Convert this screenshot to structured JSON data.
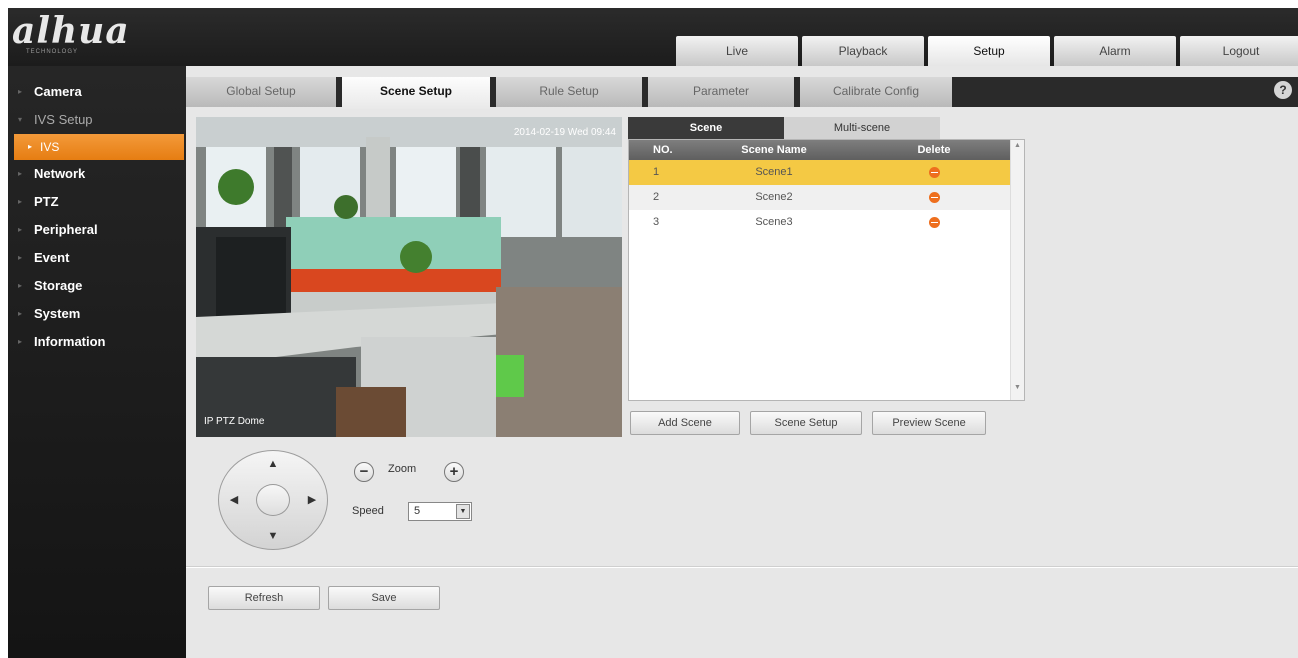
{
  "header": {
    "logo": "alhua",
    "logo_sub": "TECHNOLOGY",
    "tabs": [
      {
        "label": "Live"
      },
      {
        "label": "Playback"
      },
      {
        "label": "Setup"
      },
      {
        "label": "Alarm"
      },
      {
        "label": "Logout"
      }
    ],
    "active_tab": "Setup"
  },
  "sidebar": {
    "items": [
      {
        "label": "Camera"
      },
      {
        "label": "IVS Setup"
      },
      {
        "label": "IVS"
      },
      {
        "label": "Network"
      },
      {
        "label": "PTZ"
      },
      {
        "label": "Peripheral"
      },
      {
        "label": "Event"
      },
      {
        "label": "Storage"
      },
      {
        "label": "System"
      },
      {
        "label": "Information"
      }
    ],
    "active_item": "IVS"
  },
  "subtabs": [
    {
      "label": "Global Setup"
    },
    {
      "label": "Scene Setup"
    },
    {
      "label": "Rule Setup"
    },
    {
      "label": "Parameter"
    },
    {
      "label": "Calibrate Config"
    }
  ],
  "active_subtab": "Scene Setup",
  "video": {
    "label": "IP PTZ Dome",
    "timestamp": "2014-02-19 Wed 09:44"
  },
  "scene_panel": {
    "tabs": [
      {
        "label": "Scene"
      },
      {
        "label": "Multi-scene"
      }
    ],
    "columns": {
      "no": "NO.",
      "name": "Scene Name",
      "delete": "Delete"
    },
    "rows": [
      {
        "no": "1",
        "name": "Scene1"
      },
      {
        "no": "2",
        "name": "Scene2"
      },
      {
        "no": "3",
        "name": "Scene3"
      }
    ],
    "selected_row": 1,
    "buttons": {
      "add": "Add Scene",
      "setup": "Scene Setup",
      "preview": "Preview Scene"
    }
  },
  "ptz": {
    "zoom_label": "Zoom",
    "zoom_minus": "−",
    "zoom_plus": "+",
    "speed_label": "Speed",
    "speed_value": "5"
  },
  "footer": {
    "refresh": "Refresh",
    "save": "Save"
  },
  "colors": {
    "accent": "#e67d12",
    "selected_row": "#f4c944",
    "delete_icon": "#ee6f1e"
  }
}
